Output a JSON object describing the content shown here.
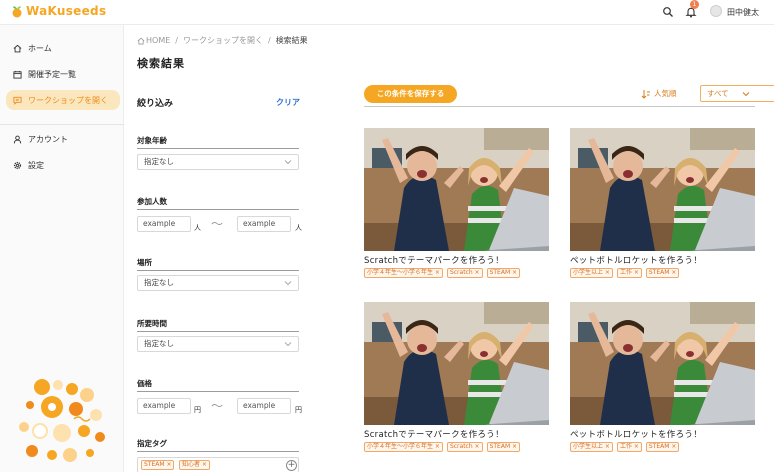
{
  "header": {
    "logo_text": "WaKuseeds",
    "notification_count": "1",
    "user_name": "田中健太"
  },
  "sidebar": {
    "items": [
      {
        "label": "ホーム",
        "icon": "home-icon"
      },
      {
        "label": "開催予定一覧",
        "icon": "calendar-icon"
      },
      {
        "label": "ワークショップを開く",
        "icon": "chat-icon",
        "active": true
      },
      {
        "label": "アカウント",
        "icon": "person-icon"
      },
      {
        "label": "設定",
        "icon": "gear-icon"
      }
    ]
  },
  "breadcrumb": {
    "home": "HOME",
    "parent": "ワークショップを開く",
    "current": "検索結果"
  },
  "page_title": "検索結果",
  "filter": {
    "title": "絞り込み",
    "clear": "クリア",
    "age": {
      "label": "対象年齢",
      "value": "指定なし"
    },
    "participants": {
      "label": "参加人数",
      "min_placeholder": "example",
      "max_placeholder": "example",
      "unit": "人",
      "tilde": "〜"
    },
    "place": {
      "label": "場所",
      "value": "指定なし"
    },
    "duration": {
      "label": "所要時間",
      "value": "指定なし"
    },
    "price": {
      "label": "価格",
      "min_placeholder": "example",
      "max_placeholder": "example",
      "unit": "円",
      "tilde": "〜"
    },
    "tags": {
      "label": "指定タグ",
      "chips": [
        "STEAM ×",
        "知心者 ×"
      ],
      "add": "+"
    }
  },
  "results": {
    "save_button": "この条件を保存する",
    "sort_label": "人気順",
    "filter_select": "すべて",
    "cards": [
      {
        "title": "Scratchでテーマパークを作ろう！",
        "tags": [
          "小学４年生〜小学６年生 ×",
          "Scratch ×",
          "STEAM ×"
        ]
      },
      {
        "title": "ペットボトルロケットを作ろう！",
        "tags": [
          "小学生以上 ×",
          "工作 ×",
          "STEAM ×"
        ]
      },
      {
        "title": "Scratchでテーマパークを作ろう！",
        "tags": [
          "小学４年生〜小学６年生 ×",
          "Scratch ×",
          "STEAM ×"
        ]
      },
      {
        "title": "ペットボトルロケットを作ろう！",
        "tags": [
          "小学生以上 ×",
          "工作 ×",
          "STEAM ×"
        ]
      }
    ]
  },
  "colors": {
    "accent": "#f5a623",
    "accent_text": "#f08a1c",
    "active_nav_bg": "#fbe7be",
    "link_blue": "#2a6fd0"
  }
}
